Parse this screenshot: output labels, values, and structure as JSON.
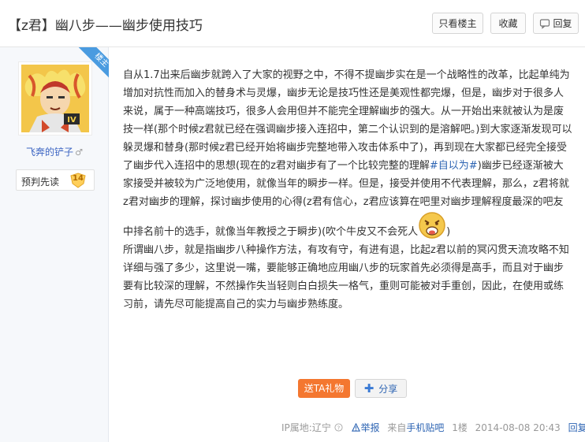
{
  "header": {
    "title": "【z君】幽八步——幽步使用技巧",
    "only_host_label": "只看楼主",
    "favorite_label": "收藏",
    "reply_label": "回复"
  },
  "user": {
    "badge": "楼主",
    "name": "飞奔的铲子",
    "gender_symbol": "♂",
    "level_name": "预判先读",
    "level": "14"
  },
  "post": {
    "p1_a": "自从1.7出来后幽步就跨入了大家的视野之中，不得不提幽步实在是一个战略性的改革，比起单纯为增加对抗性而加入的替身术与灵爆，幽步无论是技巧性还是美观性都完爆，但是，幽步对于很多人来说，属于一种高端技巧，很多人会用但并不能完全理解幽步的强大。从一开始出来就被认为是废技一样(那个时候z君就已经在强调幽步接入连招中，第二个认识到的是溶解吧。)到大家逐渐发现可以躲灵爆和替身(那时候z君已经开始将幽步完整地带入攻击体系中了)，再到现在大家都已经完全接受了幽步代入连招中的思想(现在的z君对幽步有了一个比较完整的理解",
    "p1_link": "#自以为#",
    "p1_b": ")幽步已经逐渐被大家接受并被较为广泛地使用，就像当年的瞬步一样。但是，接受并使用不代表理解，那么，z君将就z君对幽步的理解，探讨幽步使用的心得(z君有信心，z君应该算在吧里对幽步理解程度最深的吧友中排名前十的选手，就像当年教授之于瞬步)(吹个牛皮又不会死人",
    "p1_c": ")",
    "p2": "所谓幽八步，就是指幽步八种操作方法，有攻有守，有进有退，比起z君以前的冥闪贯天流攻略不知详细与强了多少，这里说一嘴，要能够正确地应用幽八步的玩家首先必须得是高手，而且对于幽步要有比较深的理解，不然操作失当轻则白白损失一格气，重则可能被对手重创，因此，在使用或练习前，请先尽可能提高自己的实力与幽步熟练度。"
  },
  "actions": {
    "gift_label": "送TA礼物",
    "share_label": "分享"
  },
  "footer": {
    "ip_label": "IP属地:辽宁",
    "report_label": "举报",
    "source_prefix": "来自",
    "source_link": "手机贴吧",
    "floor": "1楼",
    "time": "2014-08-08 20:43",
    "reply_label": "回复"
  },
  "colors": {
    "link": "#2d64b3",
    "gift": "#f47730",
    "badge": "#4a9be0"
  }
}
